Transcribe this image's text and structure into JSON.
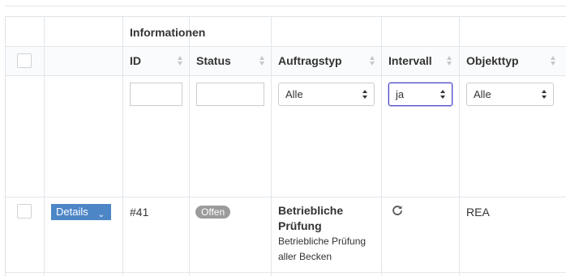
{
  "table": {
    "group_header": "Informationen",
    "columns": [
      {
        "label": "ID"
      },
      {
        "label": "Status"
      },
      {
        "label": "Auftragstyp"
      },
      {
        "label": "Intervall"
      },
      {
        "label": "Objekttyp"
      }
    ],
    "filters": {
      "id_value": "",
      "status_value": "",
      "auftragstyp_selected": "Alle",
      "intervall_selected": "ja",
      "objekttyp_selected": "Alle"
    },
    "rows": [
      {
        "details_label": "Details",
        "id": "#41",
        "status": "Offen",
        "auftragstyp_title": "Betriebliche Prüfung",
        "auftragstyp_desc": "Betriebliche Prüfung aller Becken",
        "intervall_icon": "refresh-icon",
        "objekttyp": "REA"
      }
    ]
  },
  "colors": {
    "accent_button": "#4d86c6",
    "status_badge": "#9b9b9b",
    "focus_border": "#4a46c8"
  }
}
